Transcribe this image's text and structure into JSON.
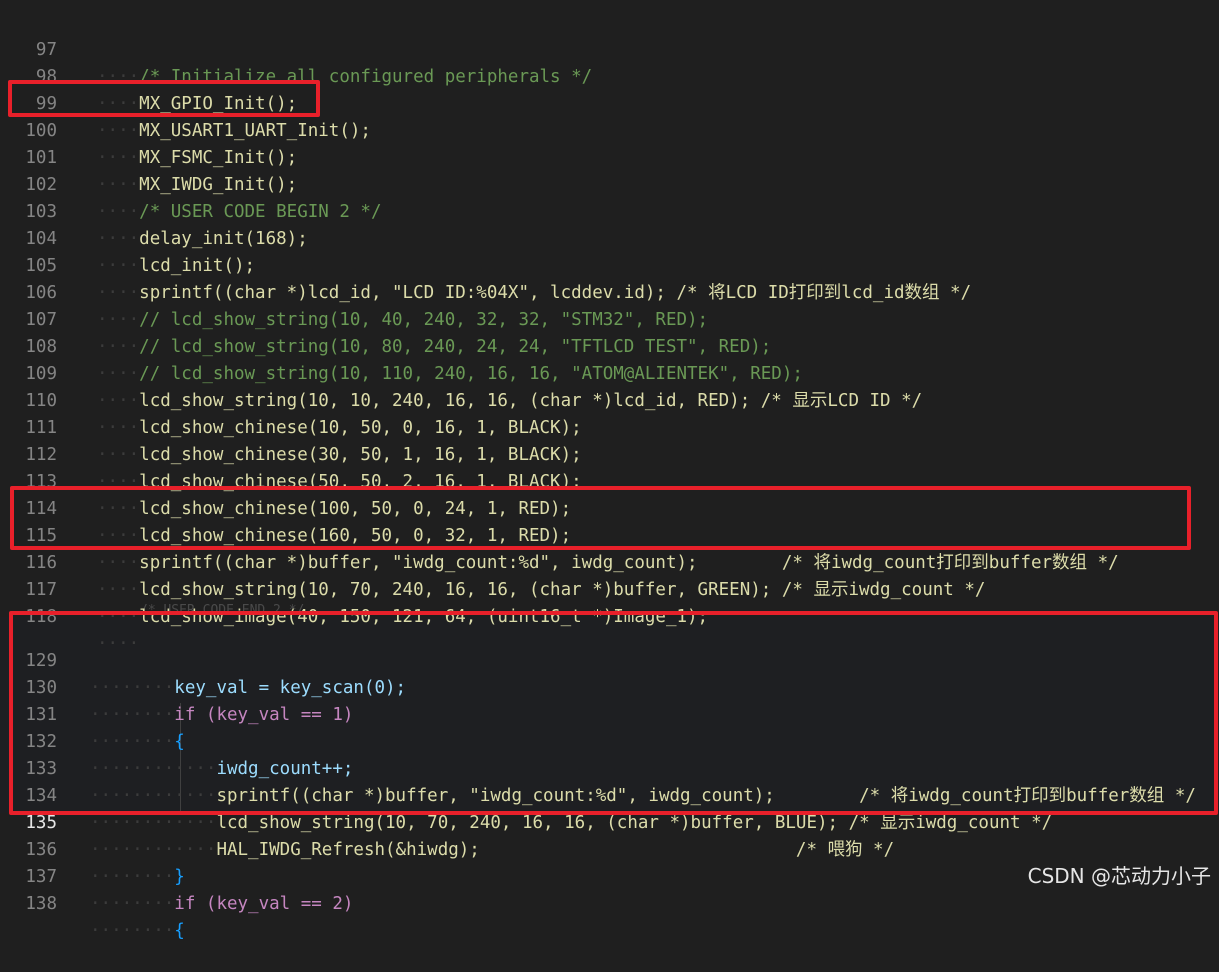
{
  "editor": {
    "lines_top": [
      {
        "n": "97",
        "code": "/* Initialize all configured peripherals */"
      },
      {
        "n": "98",
        "code": "MX_GPIO_Init();"
      },
      {
        "n": "99",
        "code": "MX_USART1_UART_Init();"
      },
      {
        "n": "100",
        "code": "MX_FSMC_Init();"
      },
      {
        "n": "101",
        "code": "MX_IWDG_Init();"
      },
      {
        "n": "102",
        "code": "/* USER CODE BEGIN 2 */"
      },
      {
        "n": "103",
        "code": "delay_init(168);"
      },
      {
        "n": "104",
        "code": "lcd_init();"
      },
      {
        "n": "105",
        "code": "sprintf((char *)lcd_id, \"LCD ID:%04X\", lcddev.id); /* 将LCD ID打印到lcd_id数组 */"
      },
      {
        "n": "106",
        "code": "// lcd_show_string(10, 40, 240, 32, 32, \"STM32\", RED);"
      },
      {
        "n": "107",
        "code": "// lcd_show_string(10, 80, 240, 24, 24, \"TFTLCD TEST\", RED);"
      },
      {
        "n": "108",
        "code": "// lcd_show_string(10, 110, 240, 16, 16, \"ATOM@ALIENTEK\", RED);"
      },
      {
        "n": "109",
        "code": "lcd_show_string(10, 10, 240, 16, 16, (char *)lcd_id, RED); /* 显示LCD ID */"
      },
      {
        "n": "110",
        "code": "lcd_show_chinese(10, 50, 0, 16, 1, BLACK);"
      },
      {
        "n": "111",
        "code": "lcd_show_chinese(30, 50, 1, 16, 1, BLACK);"
      },
      {
        "n": "112",
        "code": "lcd_show_chinese(50, 50, 2, 16, 1, BLACK);"
      },
      {
        "n": "113",
        "code": "lcd_show_chinese(100, 50, 0, 24, 1, RED);"
      },
      {
        "n": "114",
        "code": "lcd_show_chinese(160, 50, 0, 32, 1, RED);"
      },
      {
        "n": "115",
        "code": "sprintf((char *)buffer, \"iwdg_count:%d\", iwdg_count);        /* 将iwdg_count打印到buffer数组 */"
      },
      {
        "n": "116",
        "code": "lcd_show_string(10, 70, 240, 16, 16, (char *)buffer, GREEN); /* 显示iwdg_count */"
      },
      {
        "n": "117",
        "code": "lcd_show_image(40, 150, 121, 64, (uint16_t *)Image_1);"
      },
      {
        "n": "118",
        "code": ""
      }
    ],
    "lines_bottom": [
      {
        "n": "129",
        "code": "key_val = key_scan(0);"
      },
      {
        "n": "130",
        "code": "if (key_val == 1)"
      },
      {
        "n": "131",
        "code": "{"
      },
      {
        "n": "132",
        "code": "iwdg_count++;"
      },
      {
        "n": "133",
        "code": "sprintf((char *)buffer, \"iwdg_count:%d\", iwdg_count);        /* 将iwdg_count打印到buffer数组 */"
      },
      {
        "n": "134",
        "code": "lcd_show_string(10, 70, 240, 16, 16, (char *)buffer, BLUE); /* 显示iwdg_count */"
      },
      {
        "n": "135",
        "code": "HAL_IWDG_Refresh(&hiwdg);                              /* 喂狗 */"
      },
      {
        "n": "136",
        "code": "}"
      },
      {
        "n": "137",
        "code": "if (key_val == 2)"
      },
      {
        "n": "138",
        "code": "{"
      }
    ]
  },
  "watermark": "CSDN @芯动力小子",
  "colors": {
    "highlight_box": "#e8202a",
    "background": "#1f1f1f"
  }
}
